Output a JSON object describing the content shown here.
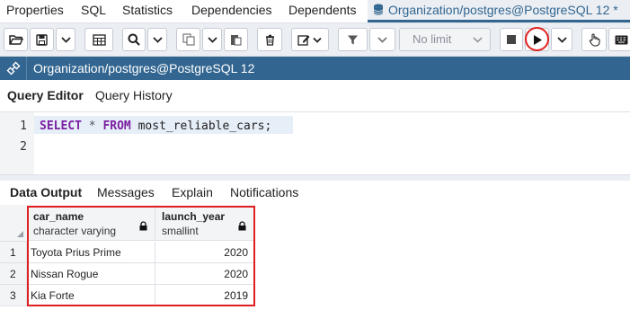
{
  "tabs": [
    {
      "label": "Properties"
    },
    {
      "label": "SQL"
    },
    {
      "label": "Statistics"
    },
    {
      "label": "Dependencies"
    },
    {
      "label": "Dependents"
    },
    {
      "label": "Organization/postgres@PostgreSQL 12 *",
      "active": true
    }
  ],
  "toolbar": {
    "limit_label": "No limit",
    "icons": [
      "open-folder-icon",
      "save-icon",
      "save-dropdown-icon",
      "table-icon",
      "search-icon",
      "search-dropdown-icon",
      "copy-icon",
      "copy-dropdown-icon",
      "paste-icon",
      "delete-icon",
      "edit-icon",
      "filter-icon",
      "filter-dropdown-icon",
      "stop-icon",
      "execute-icon",
      "execute-dropdown-icon",
      "hand-icon",
      "keyboard-icon"
    ]
  },
  "connection": {
    "label": "Organization/postgres@PostgreSQL 12"
  },
  "editor_tabs": [
    {
      "label": "Query Editor",
      "active": true
    },
    {
      "label": "Query History"
    }
  ],
  "editor": {
    "line_numbers": [
      "1",
      "2"
    ],
    "sql": {
      "kw1": "SELECT",
      "star": "*",
      "kw2": "FROM",
      "table": "most_reliable_cars;"
    }
  },
  "output_tabs": [
    {
      "label": "Data Output",
      "active": true
    },
    {
      "label": "Messages"
    },
    {
      "label": "Explain"
    },
    {
      "label": "Notifications"
    }
  ],
  "grid": {
    "columns": [
      {
        "name": "car_name",
        "type": "character varying"
      },
      {
        "name": "launch_year",
        "type": "smallint"
      }
    ],
    "rows": [
      {
        "num": "1",
        "car_name": "Toyota Prius Prime",
        "launch_year": "2020"
      },
      {
        "num": "2",
        "car_name": "Nissan Rogue",
        "launch_year": "2020"
      },
      {
        "num": "3",
        "car_name": "Kia Forte",
        "launch_year": "2019"
      }
    ]
  },
  "colors": {
    "accent": "#326690",
    "highlight": "#e02020",
    "keyword": "#7b1fa2"
  }
}
